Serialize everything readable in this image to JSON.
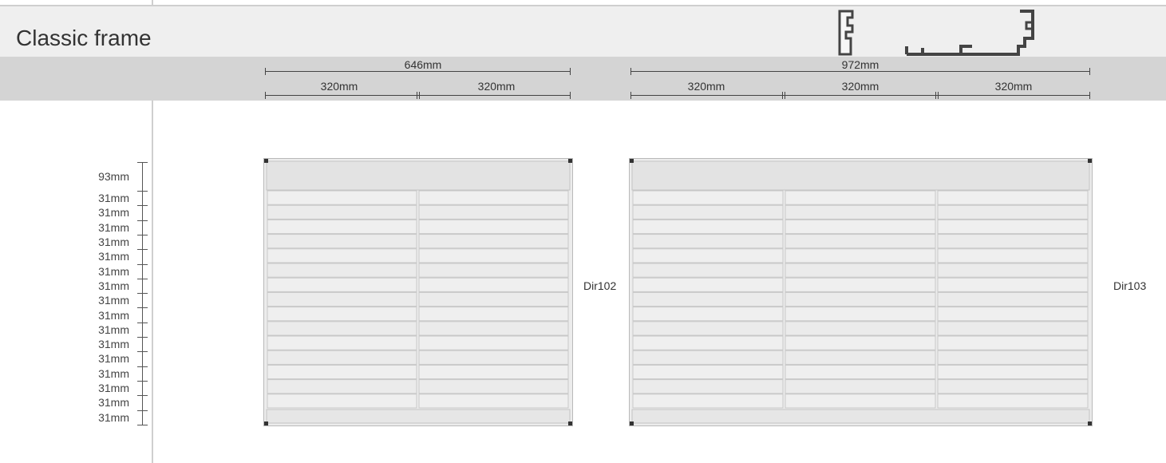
{
  "header": {
    "title": "Classic frame"
  },
  "dimensions": {
    "left_total": "646mm",
    "left_columns": [
      "320mm",
      "320mm"
    ],
    "right_total": "972mm",
    "right_columns": [
      "320mm",
      "320mm",
      "320mm"
    ]
  },
  "row_heights": [
    "93mm",
    "31mm",
    "31mm",
    "31mm",
    "31mm",
    "31mm",
    "31mm",
    "31mm",
    "31mm",
    "31mm",
    "31mm",
    "31mm",
    "31mm",
    "31mm",
    "31mm",
    "31mm",
    "31mm"
  ],
  "boards": [
    {
      "label": "Dir102",
      "columns": 2,
      "strip_rows": 15
    },
    {
      "label": "Dir103",
      "columns": 3,
      "strip_rows": 15
    }
  ],
  "colors": {
    "header_bg": "#efefef",
    "dim_band_bg": "#d4d4d4",
    "board_bg": "#ececec",
    "frame": "#b9b9b9"
  }
}
